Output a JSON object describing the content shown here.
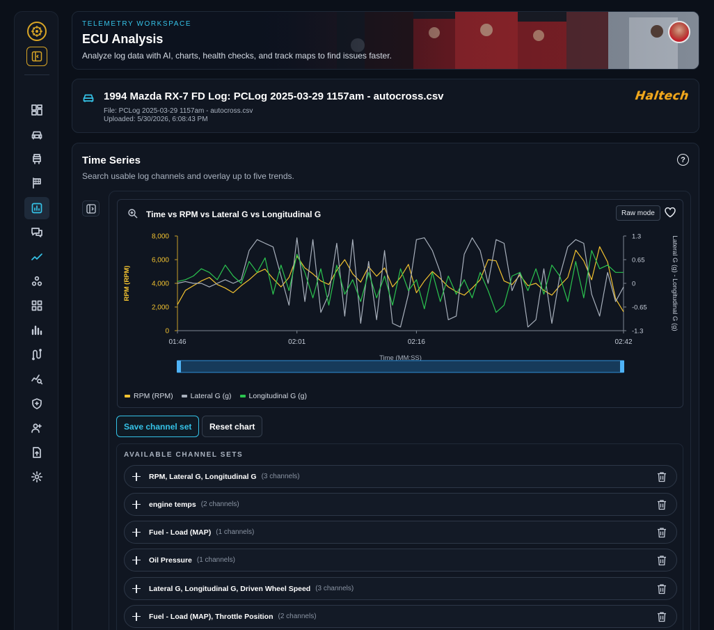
{
  "banner": {
    "kicker": "TELEMETRY WORKSPACE",
    "title": "ECU Analysis",
    "subtitle": "Analyze log data with AI, charts, health checks, and track maps to find issues faster."
  },
  "log": {
    "title": "1994 Mazda RX-7 FD Log: PCLog 2025-03-29 1157am - autocross.csv",
    "file": "File: PCLog 2025-03-29 1157am - autocross.csv",
    "uploaded": "Uploaded: 5/30/2026, 6:08:43 PM",
    "brand": "Haltech"
  },
  "sidebar": {
    "items": [
      {
        "icon": "dashboard-icon"
      },
      {
        "icon": "car-icon"
      },
      {
        "icon": "engine-icon"
      },
      {
        "icon": "checkered-flag-icon"
      },
      {
        "icon": "chart-icon",
        "active": true
      },
      {
        "icon": "chat-icon"
      },
      {
        "icon": "trend-icon",
        "accent": true
      },
      {
        "icon": "shapes-icon"
      },
      {
        "icon": "grid-icon"
      },
      {
        "icon": "bar-chart-icon"
      },
      {
        "icon": "track-icon"
      },
      {
        "icon": "analysis-icon"
      },
      {
        "icon": "shield-icon"
      },
      {
        "icon": "users-icon"
      },
      {
        "icon": "upload-icon"
      },
      {
        "icon": "gear-icon"
      }
    ]
  },
  "panel": {
    "title": "Time Series",
    "subtitle": "Search usable log channels and overlay up to five trends.",
    "help": "?"
  },
  "chart": {
    "title": "Time vs RPM vs Lateral G vs Longitudinal G",
    "raw_mode_label": "Raw mode",
    "save_label": "Save channel set",
    "reset_label": "Reset chart"
  },
  "chart_data": {
    "type": "line",
    "title": "Time vs RPM vs Lateral G vs Longitudinal G",
    "xlabel": "Time (MM:SS)",
    "ylabel": "RPM (RPM)",
    "y2label": "Lateral G (g) - Longitudinal G (g)",
    "x_ticks": [
      "01:46",
      "02:01",
      "02:16",
      "02:42"
    ],
    "y_ticks": [
      "0",
      "2,000",
      "4,000",
      "6,000",
      "8,000"
    ],
    "y2_ticks": [
      "-1.3",
      "-0.65",
      "0",
      "0.65",
      "1.3"
    ],
    "ylim": [
      0,
      8000
    ],
    "y2lim": [
      -1.3,
      1.3
    ],
    "xlim_seconds": [
      106,
      162
    ],
    "grid": false,
    "legend_position": "bottom-left",
    "series": [
      {
        "name": "RPM (RPM)",
        "axis": "left",
        "color": "#f2c230",
        "x": [
          106,
          107,
          108,
          109,
          110,
          111,
          112,
          113,
          114,
          115,
          116,
          117,
          118,
          119,
          120,
          121,
          122,
          123,
          124,
          125,
          126,
          127,
          128,
          129,
          130,
          131,
          132,
          133,
          134,
          135,
          136,
          137,
          138,
          139,
          140,
          141,
          142,
          143,
          144,
          145,
          146,
          147,
          148,
          149,
          150,
          151,
          152,
          153,
          154,
          155,
          156,
          157,
          158,
          159,
          160,
          161,
          162
        ],
        "values": [
          2200,
          3400,
          3800,
          4200,
          4500,
          3900,
          3600,
          3200,
          3800,
          4300,
          4900,
          5200,
          4400,
          3700,
          4500,
          6300,
          5300,
          4800,
          4200,
          3900,
          5100,
          6000,
          4800,
          4100,
          5400,
          4600,
          5300,
          3700,
          4500,
          5600,
          3200,
          4200,
          5000,
          4400,
          3700,
          3300,
          3000,
          3600,
          4300,
          6000,
          5900,
          4200,
          3900,
          4700,
          3800,
          4000,
          3400,
          3000,
          3800,
          4500,
          6800,
          5900,
          4300,
          7100,
          5800,
          2700,
          1600
        ]
      },
      {
        "name": "Lateral G (g)",
        "axis": "right",
        "color": "#a8b0bc",
        "x": [
          106,
          107,
          108,
          109,
          110,
          111,
          112,
          113,
          114,
          115,
          116,
          117,
          118,
          119,
          120,
          121,
          122,
          123,
          124,
          125,
          126,
          127,
          128,
          129,
          130,
          131,
          132,
          133,
          134,
          135,
          136,
          137,
          138,
          139,
          140,
          141,
          142,
          143,
          144,
          145,
          146,
          147,
          148,
          149,
          150,
          151,
          152,
          153,
          154,
          155,
          156,
          157,
          158,
          159,
          160,
          161,
          162
        ],
        "values": [
          0.0,
          0.05,
          0.0,
          0.0,
          -0.1,
          0.0,
          0.1,
          0.0,
          0.1,
          0.9,
          1.2,
          1.1,
          1.0,
          0.2,
          -0.6,
          1.25,
          -0.5,
          1.2,
          -0.8,
          -0.3,
          1.1,
          -0.9,
          1.2,
          -1.1,
          0.6,
          -1.0,
          0.9,
          -1.1,
          -1.2,
          -0.3,
          1.2,
          1.25,
          0.9,
          0.3,
          -1.0,
          -0.9,
          0.8,
          1.25,
          0.9,
          0.0,
          1.2,
          1.1,
          -0.2,
          0.3,
          -1.2,
          -1.0,
          0.4,
          -1.1,
          0.2,
          1.0,
          1.2,
          1.1,
          -0.3,
          -0.9,
          0.3,
          -0.5,
          -0.1
        ]
      },
      {
        "name": "Longitudinal G (g)",
        "axis": "right",
        "color": "#2bc44f",
        "x": [
          106,
          107,
          108,
          109,
          110,
          111,
          112,
          113,
          114,
          115,
          116,
          117,
          118,
          119,
          120,
          121,
          122,
          123,
          124,
          125,
          126,
          127,
          128,
          129,
          130,
          131,
          132,
          133,
          134,
          135,
          136,
          137,
          138,
          139,
          140,
          141,
          142,
          143,
          144,
          145,
          146,
          147,
          148,
          149,
          150,
          151,
          152,
          153,
          154,
          155,
          156,
          157,
          158,
          159,
          160,
          161,
          162
        ],
        "values": [
          0.05,
          0.1,
          0.2,
          0.4,
          0.3,
          0.1,
          0.5,
          0.2,
          0.0,
          0.6,
          0.3,
          0.7,
          -0.3,
          0.5,
          -0.2,
          0.8,
          0.3,
          -0.4,
          0.4,
          -0.6,
          0.5,
          -0.3,
          0.1,
          -0.5,
          0.3,
          -0.4,
          0.2,
          -0.6,
          0.4,
          -0.2,
          0.1,
          -0.7,
          0.3,
          -0.5,
          0.2,
          -0.3,
          0.1,
          -0.4,
          0.3,
          -0.2,
          -0.8,
          -0.6,
          0.2,
          0.3,
          -0.2,
          0.4,
          -0.3,
          0.5,
          0.2,
          -0.5,
          0.6,
          -0.4,
          0.9,
          0.4,
          0.5,
          0.3,
          0.3
        ]
      }
    ],
    "range_selector": [
      0,
      1
    ]
  },
  "legend": [
    {
      "name": "RPM (RPM)",
      "color": "#f2c230"
    },
    {
      "name": "Lateral G (g)",
      "color": "#a8b0bc"
    },
    {
      "name": "Longitudinal G (g)",
      "color": "#2bc44f"
    }
  ],
  "channel_sets": {
    "title": "AVAILABLE CHANNEL SETS",
    "items": [
      {
        "name": "RPM, Lateral G, Longitudinal G",
        "count": "(3 channels)"
      },
      {
        "name": "engine temps",
        "count": "(2 channels)"
      },
      {
        "name": "Fuel - Load (MAP)",
        "count": "(1 channels)"
      },
      {
        "name": "Oil Pressure",
        "count": "(1 channels)"
      },
      {
        "name": "Lateral G, Longitudinal G, Driven Wheel Speed",
        "count": "(3 channels)"
      },
      {
        "name": "Fuel - Load (MAP), Throttle Position",
        "count": "(2 channels)"
      }
    ]
  }
}
